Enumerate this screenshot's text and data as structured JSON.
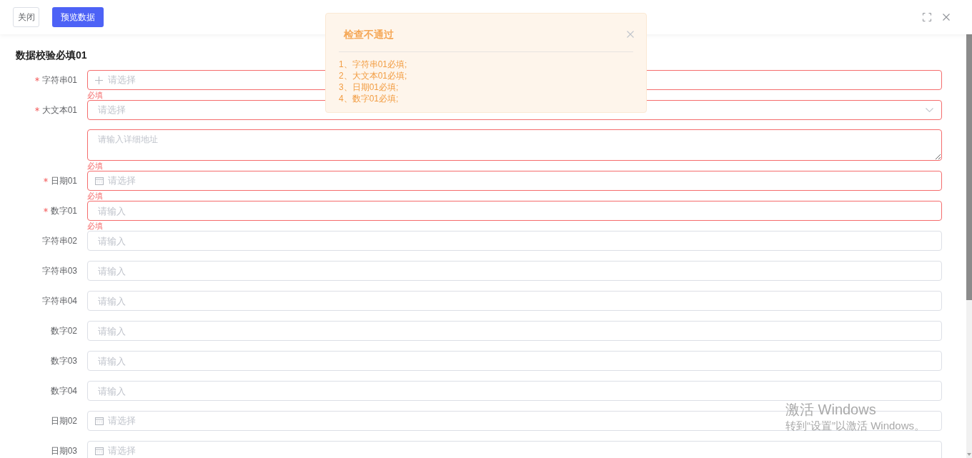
{
  "toolbar": {
    "buttons": [
      {
        "label": "关闭",
        "kind": "default"
      },
      {
        "label": "预览数据",
        "kind": "primary"
      }
    ]
  },
  "form": {
    "title": "数据校验必填01",
    "fields": [
      {
        "label": "字符串01",
        "required": true,
        "kind": "picker",
        "placeholder": "请选择",
        "error": "必填"
      },
      {
        "label": "大文本01",
        "required": true,
        "kind": "address",
        "placeholder": "请选择",
        "detail_placeholder": "请输入详细地址",
        "error": "必填"
      },
      {
        "label": "日期01",
        "required": true,
        "kind": "date",
        "placeholder": "请选择",
        "error": "必填"
      },
      {
        "label": "数字01",
        "required": true,
        "kind": "input",
        "placeholder": "请输入",
        "error": "必填"
      },
      {
        "label": "字符串02",
        "required": false,
        "kind": "input",
        "placeholder": "请输入"
      },
      {
        "label": "字符串03",
        "required": false,
        "kind": "input",
        "placeholder": "请输入"
      },
      {
        "label": "字符串04",
        "required": false,
        "kind": "input",
        "placeholder": "请输入"
      },
      {
        "label": "数字02",
        "required": false,
        "kind": "input",
        "placeholder": "请输入"
      },
      {
        "label": "数字03",
        "required": false,
        "kind": "input",
        "placeholder": "请输入"
      },
      {
        "label": "数字04",
        "required": false,
        "kind": "input",
        "placeholder": "请输入"
      },
      {
        "label": "日期02",
        "required": false,
        "kind": "date",
        "placeholder": "请选择"
      },
      {
        "label": "日期03",
        "required": false,
        "kind": "date",
        "placeholder": "请选择"
      }
    ]
  },
  "alert": {
    "title": "检查不通过",
    "messages": [
      "1、字符串01必填;",
      "2、大文本01必填;",
      "3、日期01必填;",
      "4、数字01必填;"
    ]
  },
  "activation_notice": {
    "title": "激活 Windows",
    "message": "转到“设置”以激活 Windows。"
  }
}
